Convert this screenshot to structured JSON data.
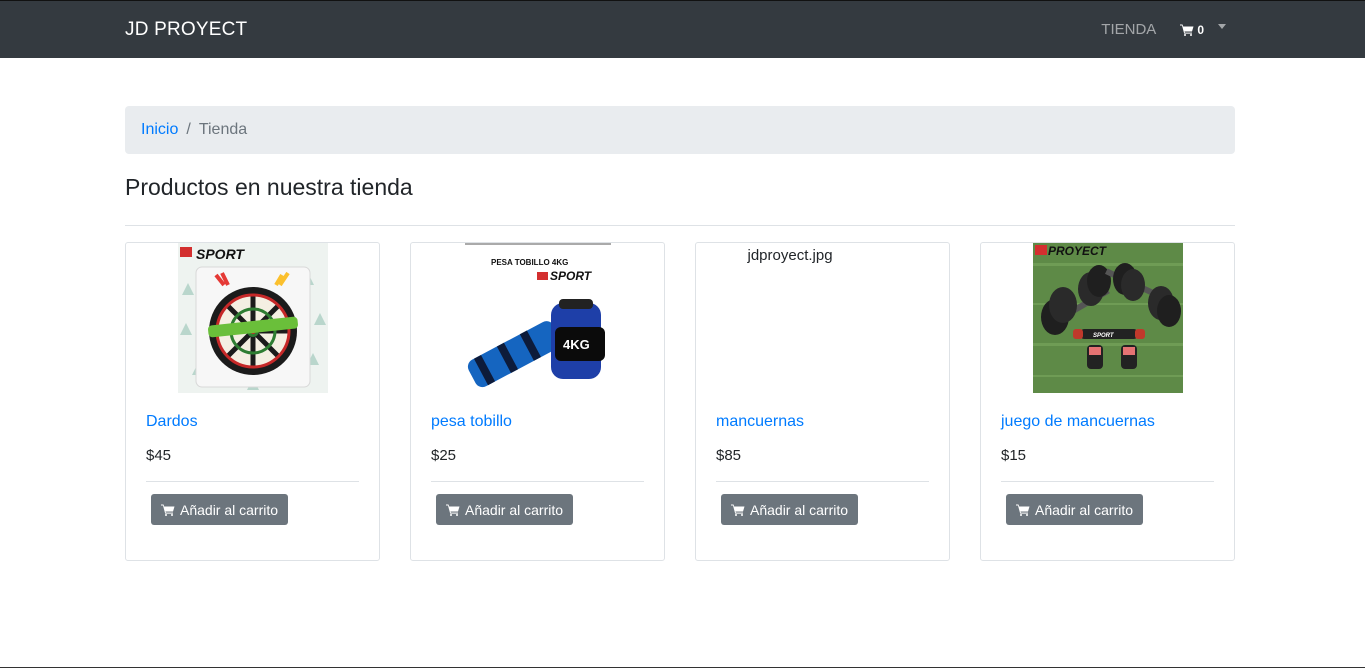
{
  "navbar": {
    "brand": "JD PROYECT",
    "shop_link": "TIENDA",
    "cart_count": "0"
  },
  "breadcrumb": {
    "home": "Inicio",
    "separator": "/",
    "current": "Tienda"
  },
  "page_title": "Productos en nuestra tienda",
  "products": [
    {
      "name": "Dardos",
      "price": "$45",
      "button": "Añadir al carrito",
      "image_logo": "SPORT"
    },
    {
      "name": "pesa tobillo",
      "price": "$25",
      "button": "Añadir al carrito",
      "image_caption": "PESA TOBILLO 4KG",
      "image_logo": "SPORT",
      "image_badge": "4KG"
    },
    {
      "name": "mancuernas",
      "price": "$85",
      "button": "Añadir al carrito",
      "image_alt": "jdproyect.jpg"
    },
    {
      "name": "juego de mancuernas",
      "price": "$15",
      "button": "Añadir al carrito",
      "image_logo": "PROYECT",
      "image_sublogo": "SPORT"
    }
  ],
  "colors": {
    "navbar": "#343a40",
    "link": "#007bff",
    "button": "#6c757d",
    "breadcrumb_bg": "#e9ecef"
  }
}
